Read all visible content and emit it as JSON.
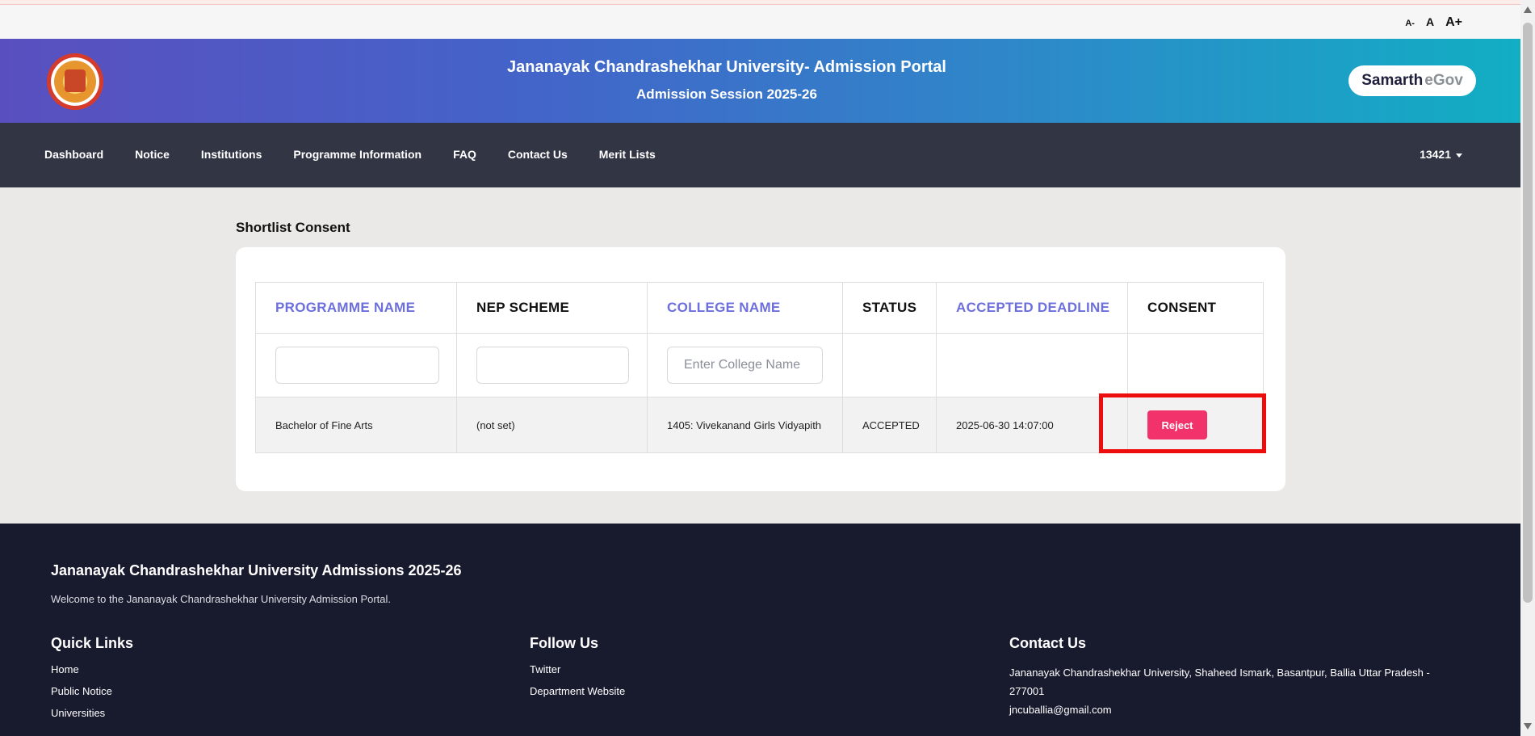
{
  "font_controls": {
    "small": "A-",
    "normal": "A",
    "large": "A+"
  },
  "header": {
    "title": "Jananayak Chandrashekhar University- Admission Portal",
    "subtitle": "Admission Session 2025-26",
    "brand_part1": "Samarth",
    "brand_part2": "eGov"
  },
  "nav": {
    "items": [
      "Dashboard",
      "Notice",
      "Institutions",
      "Programme Information",
      "FAQ",
      "Contact Us",
      "Merit Lists"
    ],
    "user": "13421"
  },
  "page": {
    "title": "Shortlist Consent"
  },
  "table": {
    "columns": [
      "PROGRAMME NAME",
      "NEP SCHEME",
      "COLLEGE NAME",
      "STATUS",
      "ACCEPTED DEADLINE",
      "CONSENT"
    ],
    "filter_placeholder_college": "Enter College Name",
    "rows": [
      {
        "programme": "Bachelor of Fine Arts",
        "nep": "(not set)",
        "college": "1405: Vivekanand Girls Vidyapith",
        "status": "ACCEPTED",
        "deadline": "2025-06-30 14:07:00",
        "action": "Reject"
      }
    ]
  },
  "colors": {
    "accent": "#6c6fdc",
    "reject": "#f2336b",
    "highlight": "#ee0d0d",
    "nav_bg": "#323543",
    "footer_bg": "#181b2e"
  },
  "footer": {
    "title": "Jananayak Chandrashekhar University Admissions 2025-26",
    "welcome": "Welcome to the Jananayak Chandrashekhar University Admission Portal.",
    "quick_links_title": "Quick Links",
    "quick_links": [
      "Home",
      "Public Notice",
      "Universities"
    ],
    "follow_title": "Follow Us",
    "follow_links": [
      "Twitter",
      "Department Website"
    ],
    "contact_title": "Contact Us",
    "address": "Jananayak Chandrashekhar University, Shaheed Ismark, Basantpur, Ballia  Uttar Pradesh - 277001",
    "email": "jncuballia@gmail.com"
  }
}
